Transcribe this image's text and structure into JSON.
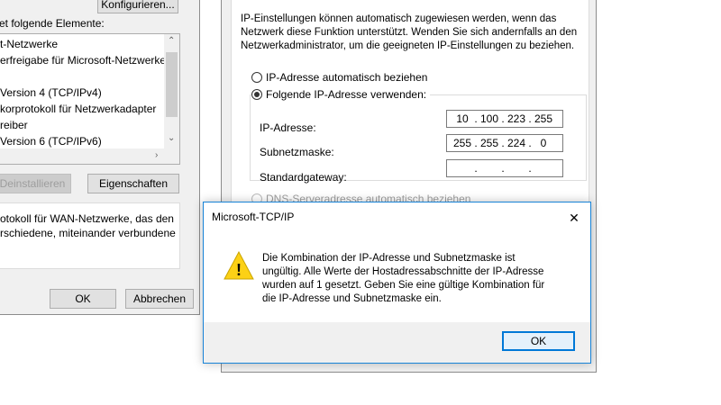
{
  "left_dialog": {
    "configure_button": "Konfigurieren...",
    "elements_label": "et folgende Elemente:",
    "components": [
      "t-Netzwerke",
      "erfreigabe für Microsoft-Netzwerke",
      "",
      "Version 4 (TCP/IPv4)",
      "korprotokoll für Netzwerkadapter",
      "reiber",
      "Version 6 (TCP/IPv6)"
    ],
    "uninstall_button": "Deinstallieren",
    "properties_button": "Eigenschaften",
    "description_lines": [
      "otokoll für WAN-Netzwerke, das den",
      "rschiedene, miteinander verbundene"
    ],
    "ok_button": "OK",
    "cancel_button": "Abbrechen"
  },
  "ipv4_dialog": {
    "info_lines": [
      "IP-Einstellungen können automatisch zugewiesen werden, wenn das",
      "Netzwerk diese Funktion unterstützt. Wenden Sie sich andernfalls an den",
      "Netzwerkadministrator, um die geeigneten IP-Einstellungen zu beziehen."
    ],
    "radio_auto_ip": "IP-Adresse automatisch beziehen",
    "radio_manual_ip": "Folgende IP-Adresse verwenden:",
    "ip_label": "IP-Adresse:",
    "ip_octets": [
      "10",
      "100",
      "223",
      "255"
    ],
    "subnet_label": "Subnetzmaske:",
    "subnet_octets": [
      "255",
      "255",
      "224",
      "0"
    ],
    "gateway_label": "Standardgateway:",
    "gateway_octets": [
      "",
      "",
      "",
      ""
    ],
    "radio_auto_dns": "DNS-Serveradresse automatisch beziehen"
  },
  "message_box": {
    "title": "Microsoft-TCP/IP",
    "close_symbol": "✕",
    "warning_symbol": "!",
    "message_lines": [
      "Die Kombination der IP-Adresse und Subnetzmaske ist",
      "ungültig. Alle Werte der Hostadressabschnitte der IP-Adresse",
      "wurden auf 1 gesetzt. Geben Sie eine gültige Kombination für",
      "die IP-Adresse und Subnetzmaske ein."
    ],
    "ok_button": "OK"
  },
  "colors": {
    "accent": "#0078d7",
    "warning": "#fcd116"
  }
}
